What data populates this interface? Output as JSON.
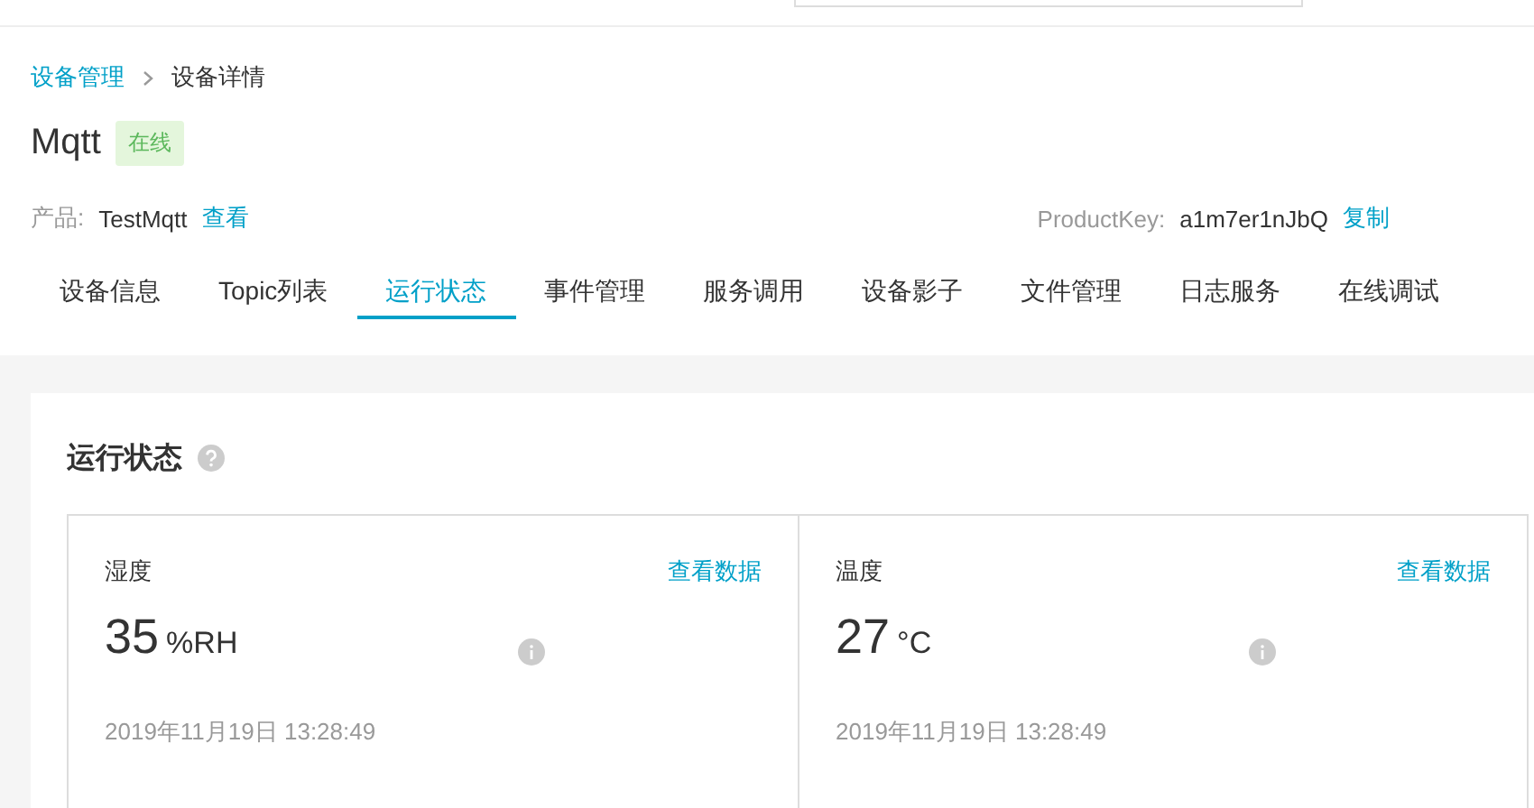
{
  "breadcrumb": [
    {
      "label": "设备管理",
      "link": true
    },
    {
      "label": "设备详情",
      "link": false
    }
  ],
  "device": {
    "name": "Mqtt",
    "status": "在线",
    "online": true
  },
  "product": {
    "label": "产品:",
    "value": "TestMqtt",
    "action": "查看"
  },
  "product_key": {
    "label": "ProductKey:",
    "value": "a1m7er1nJbQ",
    "action": "复制"
  },
  "tabs": [
    {
      "label": "设备信息",
      "selected": false
    },
    {
      "label": "Topic列表",
      "selected": false
    },
    {
      "label": "运行状态",
      "selected": true
    },
    {
      "label": "事件管理",
      "selected": false
    },
    {
      "label": "服务调用",
      "selected": false
    },
    {
      "label": "设备影子",
      "selected": false
    },
    {
      "label": "文件管理",
      "selected": false
    },
    {
      "label": "日志服务",
      "selected": false
    },
    {
      "label": "在线调试",
      "selected": false
    }
  ],
  "section": {
    "title": "运行状态"
  },
  "metrics": [
    {
      "name": "湿度",
      "action": "查看数据",
      "value": "35",
      "unit": "%RH",
      "time": "2019年11月19日 13:28:49"
    },
    {
      "name": "温度",
      "action": "查看数据",
      "value": "27",
      "unit": "°C",
      "time": "2019年11月19日 13:28:49"
    }
  ]
}
